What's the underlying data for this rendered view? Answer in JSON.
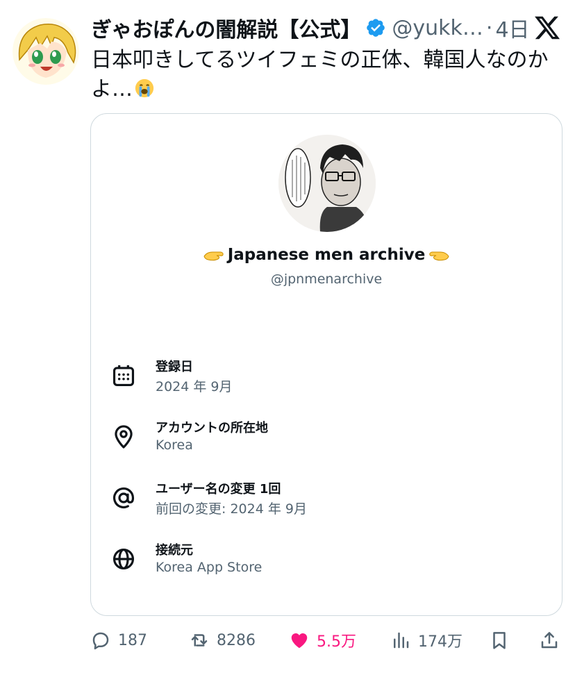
{
  "tweet": {
    "author_name": "ぎゃおぽんの闇解説【公式】",
    "handle": "@yukk…",
    "separator": "·",
    "time": "4日",
    "text": "日本叩きしてるツイフェミの正体、韓国人なのかよ…"
  },
  "card": {
    "account_name": "Japanese men archive",
    "account_handle": "@jpnmenarchive",
    "rows": [
      {
        "label": "登録日",
        "value": "2024 年 9月",
        "icon": "calendar-icon"
      },
      {
        "label": "アカウントの所在地",
        "value": "Korea",
        "icon": "location-pin-icon"
      },
      {
        "label": "ユーザー名の変更 1回",
        "value": "前回の変更: 2024 年 9月",
        "icon": "at-sign-icon"
      },
      {
        "label": "接続元",
        "value": "Korea App Store",
        "icon": "globe-icon"
      }
    ]
  },
  "actions": {
    "replies": "187",
    "reposts": "8286",
    "likes": "5.5万",
    "views": "174万"
  },
  "colors": {
    "text": "#0f1419",
    "secondary": "#536471",
    "border": "#cfd9de",
    "verified": "#1d9bf0",
    "like": "#f91880"
  }
}
